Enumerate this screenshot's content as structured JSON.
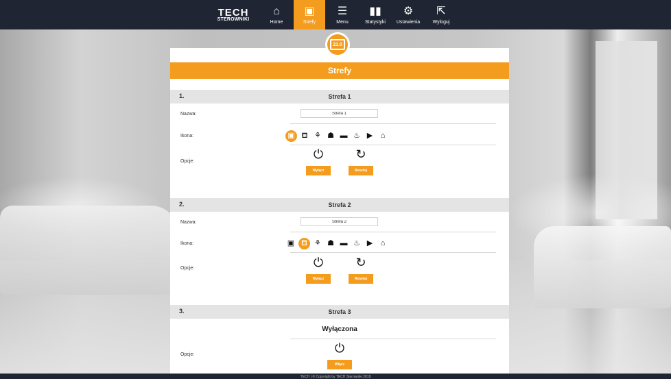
{
  "nav": {
    "brand": "TECH",
    "brand_sub": "STEROWNIKI",
    "items": [
      {
        "label": "Home",
        "icon": "home-icon",
        "glyph": "⌂"
      },
      {
        "label": "Strefy",
        "icon": "zones-icon",
        "glyph": "▣",
        "active": true
      },
      {
        "label": "Menu",
        "icon": "menu-icon",
        "glyph": "☰"
      },
      {
        "label": "Statystyki",
        "icon": "stats-icon",
        "glyph": "▮▮"
      },
      {
        "label": "Ustawienia",
        "icon": "settings-icon",
        "glyph": "⚙"
      },
      {
        "label": "Wyloguj",
        "icon": "logout-icon",
        "glyph": "⇱"
      }
    ]
  },
  "badge": {
    "value": "21.0"
  },
  "page_title": "Strefy",
  "labels": {
    "name": "Nazwa:",
    "icon": "Ikona:",
    "options": "Opcje:"
  },
  "zone_icons": [
    "▣",
    "⛾",
    "⚘",
    "☗",
    "▬",
    "♨",
    "▶",
    "⌂"
  ],
  "zones": [
    {
      "number": "1.",
      "title": "Strefa 1",
      "name_value": "Strefa 1",
      "selected_icon_index": 0,
      "btn_off": "Wyłącz",
      "btn_reset": "Resetuj"
    },
    {
      "number": "2.",
      "title": "Strefa 2",
      "name_value": "Strefa 2",
      "selected_icon_index": 1,
      "btn_off": "Wyłącz",
      "btn_reset": "Resetuj"
    },
    {
      "number": "3.",
      "title": "Strefa 3",
      "status": "Wyłączona",
      "btn_on": "Włącz"
    }
  ],
  "footer": "TECH | © Copyright by TECH Sterowniki 2019",
  "colors": {
    "accent": "#f39c1d",
    "navbar": "#1f2532",
    "zone_header": "#e4e4e4"
  }
}
